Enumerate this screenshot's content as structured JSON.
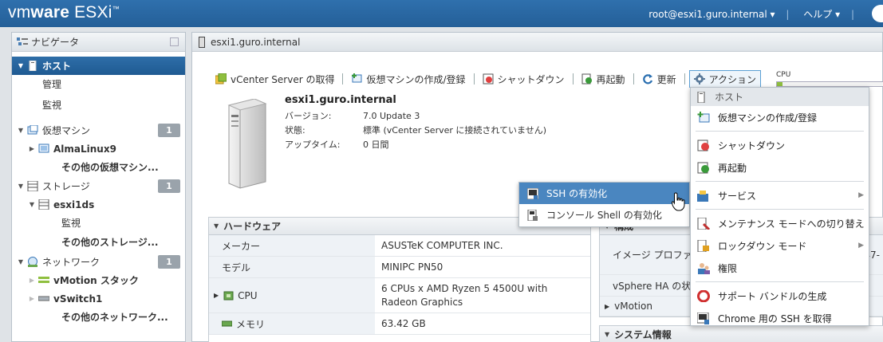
{
  "topbar": {
    "brand_vm": "vm",
    "brand_ware": "ware",
    "brand_product": "ESXi",
    "user": "root@esxi1.guro.internal",
    "help": "ヘルプ"
  },
  "navigator": {
    "title": "ナビゲータ",
    "host": "ホスト",
    "manage": "管理",
    "monitor": "監視",
    "vms": {
      "label": "仮想マシン",
      "count": "1"
    },
    "vm1": "AlmaLinux9",
    "vm_more": "その他の仮想マシン...",
    "storage": {
      "label": "ストレージ",
      "count": "1"
    },
    "ds1": "esxi1ds",
    "ds_monitor": "監視",
    "storage_more": "その他のストレージ...",
    "network": {
      "label": "ネットワーク",
      "count": "1"
    },
    "net1": "vMotion スタック",
    "net2": "vSwitch1",
    "network_more": "その他のネットワーク..."
  },
  "main": {
    "title": "esxi1.guro.internal",
    "toolbar": {
      "vcenter": "vCenter Server の取得",
      "create_vm": "仮想マシンの作成/登録",
      "shutdown": "シャットダウン",
      "reboot": "再起動",
      "refresh": "更新",
      "actions": "アクション"
    },
    "cpu_label": "CPU",
    "cpu_usage_fraction": 0.05,
    "host": {
      "name": "esxi1.guro.internal",
      "version_label": "バージョン:",
      "version": "7.0 Update 3",
      "state_label": "状態:",
      "state": "標準 (vCenter Server に接続されていません)",
      "uptime_label": "アップタイム:",
      "uptime": "0 日間"
    },
    "hardware": {
      "title": "ハードウェア",
      "rows": [
        {
          "k": "メーカー",
          "v": "ASUSTeK COMPUTER INC."
        },
        {
          "k": "モデル",
          "v": "MINIPC PN50"
        },
        {
          "k": "CPU",
          "v": "6 CPUs x AMD Ryzen 5 4500U with Radeon Graphics"
        },
        {
          "k": "メモリ",
          "v": "63.42 GB"
        }
      ]
    },
    "config": {
      "header_partial": "構成",
      "image_profile": "イメージ プロファ",
      "image_profile_value": "47-",
      "vsphere_ha": "vSphere HA の状態",
      "vmotion": "vMotion"
    },
    "sysinfo_title": "システム情報"
  },
  "ssh_submenu": {
    "enable_ssh": "SSH の有効化",
    "enable_shell": "コンソール Shell の有効化"
  },
  "actions_menu": {
    "header": "ホスト",
    "create_vm": "仮想マシンの作成/登録",
    "shutdown": "シャットダウン",
    "reboot": "再起動",
    "services": "サービス",
    "maintenance": "メンテナンス モードへの切り替え",
    "lockdown": "ロックダウン モード",
    "permissions": "権限",
    "support_bundle": "サポート バンドルの生成",
    "chrome_ssh": "Chrome 用の SSH を取得"
  }
}
